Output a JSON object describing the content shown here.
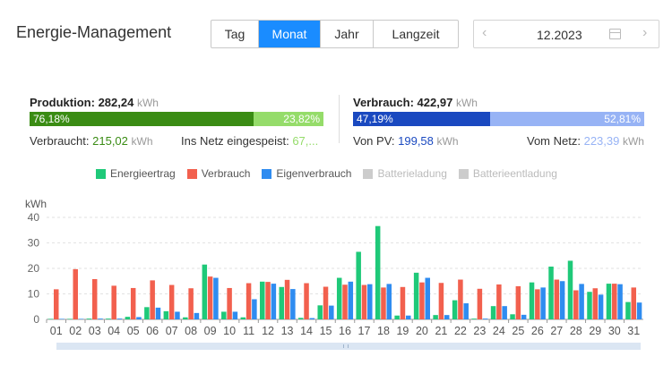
{
  "header": {
    "title": "Energie-Management"
  },
  "tabs": [
    {
      "label": "Tag",
      "active": false
    },
    {
      "label": "Monat",
      "active": true
    },
    {
      "label": "Jahr",
      "active": false
    },
    {
      "label": "Langzeit",
      "active": false
    }
  ],
  "date_picker": {
    "value": "12.2023",
    "prev_icon": "chevron-left-icon",
    "next_icon": "chevron-right-icon",
    "calendar_icon": "calendar-icon"
  },
  "production": {
    "label": "Produktion:",
    "value": "282,24",
    "unit": "kWh",
    "self_pct": "76,18%",
    "grid_pct": "23,82%",
    "self_fraction": 0.7618,
    "consumed_label": "Verbraucht:",
    "consumed_value": "215,02",
    "consumed_unit": "kWh",
    "fed_label": "Ins Netz eingespeist:",
    "fed_value": "67,...",
    "color_dark": "#3a8c14",
    "color_light": "#95dc6a"
  },
  "consumption": {
    "label": "Verbrauch:",
    "value": "422,97",
    "unit": "kWh",
    "pv_pct": "47,19%",
    "grid_pct": "52,81%",
    "pv_fraction": 0.4719,
    "pv_label": "Von PV:",
    "pv_value": "199,58",
    "pv_unit": "kWh",
    "grid_label": "Vom Netz:",
    "grid_value": "223,39",
    "grid_unit": "kWh",
    "color_dark": "#1a49c0",
    "color_light": "#97b3f5"
  },
  "legend": [
    {
      "label": "Energieertrag",
      "color": "#1fc979",
      "enabled": true
    },
    {
      "label": "Verbrauch",
      "color": "#f2604e",
      "enabled": true
    },
    {
      "label": "Eigenverbrauch",
      "color": "#2f8cf0",
      "enabled": true
    },
    {
      "label": "Batterieladung",
      "color": "#cccccc",
      "enabled": false
    },
    {
      "label": "Batterieentladung",
      "color": "#cccccc",
      "enabled": false
    }
  ],
  "chart_data": {
    "type": "bar",
    "ylabel": "kWh",
    "ylim": [
      0,
      40
    ],
    "yticks": [
      0,
      10,
      20,
      30,
      40
    ],
    "grid": true,
    "categories": [
      "01",
      "02",
      "03",
      "04",
      "05",
      "06",
      "07",
      "08",
      "09",
      "10",
      "11",
      "12",
      "13",
      "14",
      "15",
      "16",
      "17",
      "18",
      "19",
      "20",
      "21",
      "22",
      "23",
      "24",
      "25",
      "26",
      "27",
      "28",
      "29",
      "30",
      "31"
    ],
    "series": [
      {
        "name": "Energieertrag",
        "color": "#1fc979",
        "values": [
          0.2,
          0.2,
          0.3,
          0.3,
          1.0,
          4.8,
          3.2,
          0.8,
          21.5,
          3.0,
          0.8,
          14.8,
          12.7,
          0.6,
          5.5,
          16.3,
          26.5,
          36.6,
          1.5,
          18.3,
          1.7,
          7.5,
          0.3,
          5.2,
          2.0,
          14.5,
          20.7,
          23.0,
          10.8,
          14.0,
          6.8
        ]
      },
      {
        "name": "Verbrauch",
        "color": "#f2604e",
        "values": [
          11.8,
          19.7,
          15.8,
          13.2,
          12.3,
          15.3,
          13.5,
          12.2,
          16.8,
          12.3,
          14.2,
          14.7,
          15.5,
          14.2,
          12.8,
          13.6,
          13.5,
          12.5,
          12.7,
          14.5,
          14.3,
          15.6,
          12.0,
          13.7,
          13.0,
          11.8,
          15.6,
          11.4,
          12.2,
          14.0,
          12.5
        ]
      },
      {
        "name": "Eigenverbrauch",
        "color": "#2f8cf0",
        "values": [
          0.2,
          0.2,
          0.3,
          0.3,
          0.9,
          4.6,
          3.0,
          2.5,
          16.3,
          3.0,
          7.9,
          14.0,
          11.9,
          0.5,
          5.4,
          14.8,
          13.8,
          13.9,
          1.5,
          16.3,
          1.7,
          6.3,
          0.3,
          5.2,
          1.8,
          12.5,
          15.0,
          13.9,
          9.7,
          13.8,
          6.6
        ]
      }
    ]
  }
}
